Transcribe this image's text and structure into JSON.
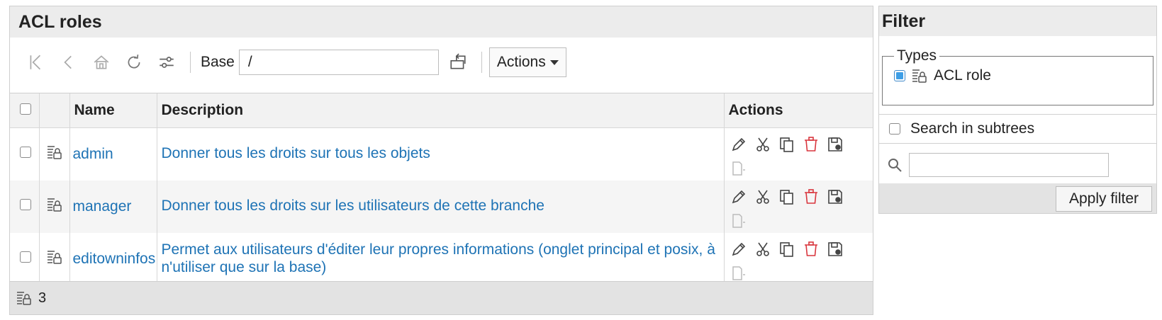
{
  "main": {
    "title": "ACL roles",
    "toolbar": {
      "base_label": "Base",
      "base_value": "/",
      "actions_label": "Actions"
    },
    "table": {
      "columns": [
        "Name",
        "Description",
        "Actions"
      ],
      "rows": [
        {
          "name": "admin",
          "description": "Donner tous les droits sur tous les objets"
        },
        {
          "name": "manager",
          "description": "Donner tous les droits sur les utilisateurs de cette branche"
        },
        {
          "name": "editowninfos",
          "description": "Permet aux utilisateurs d'éditer leur propres informations (onglet principal et posix, à n'utiliser que sur la base)"
        }
      ]
    },
    "footer": {
      "count": "3"
    }
  },
  "filter": {
    "title": "Filter",
    "types_legend": "Types",
    "type_label": "ACL role",
    "subtree_label": "Search in subtrees",
    "search_value": "",
    "apply_label": "Apply filter"
  },
  "colors": {
    "link": "#1e73b5",
    "delete": "#d9363e",
    "header_bg": "#ececec"
  }
}
